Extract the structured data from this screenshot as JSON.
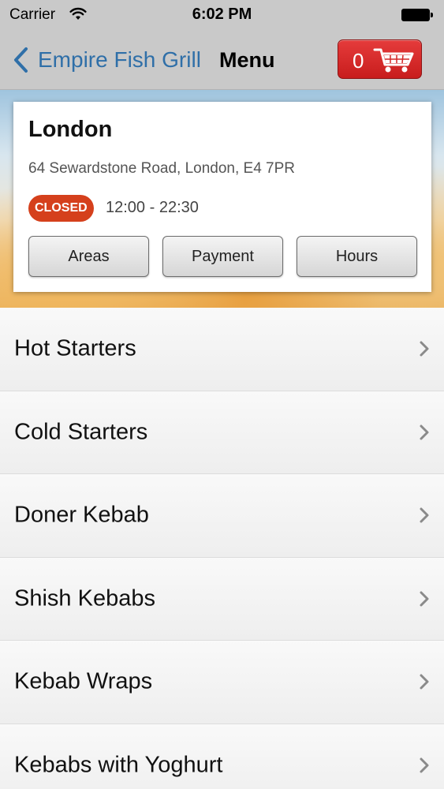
{
  "status_bar": {
    "carrier": "Carrier",
    "time": "6:02 PM"
  },
  "nav": {
    "back_label": "Empire Fish Grill",
    "title": "Menu",
    "cart_count": "0"
  },
  "location": {
    "name": "London",
    "address": "64 Sewardstone Road, London, E4 7PR",
    "status": "CLOSED",
    "hours": "12:00 - 22:30",
    "buttons": {
      "areas": "Areas",
      "payment": "Payment",
      "hours": "Hours"
    }
  },
  "menu": {
    "items": [
      {
        "label": "Hot Starters"
      },
      {
        "label": "Cold Starters"
      },
      {
        "label": "Doner Kebab"
      },
      {
        "label": "Shish Kebabs"
      },
      {
        "label": "Kebab Wraps"
      },
      {
        "label": "Kebabs with Yoghurt"
      }
    ]
  },
  "colors": {
    "accent_blue": "#2f6fa8",
    "cart_red": "#d32626",
    "closed_badge": "#d5401c"
  },
  "icons": {
    "back": "chevron-left-icon",
    "cart": "shopping-cart-icon",
    "disclosure": "chevron-right-icon",
    "wifi": "wifi-icon",
    "battery": "battery-icon"
  }
}
